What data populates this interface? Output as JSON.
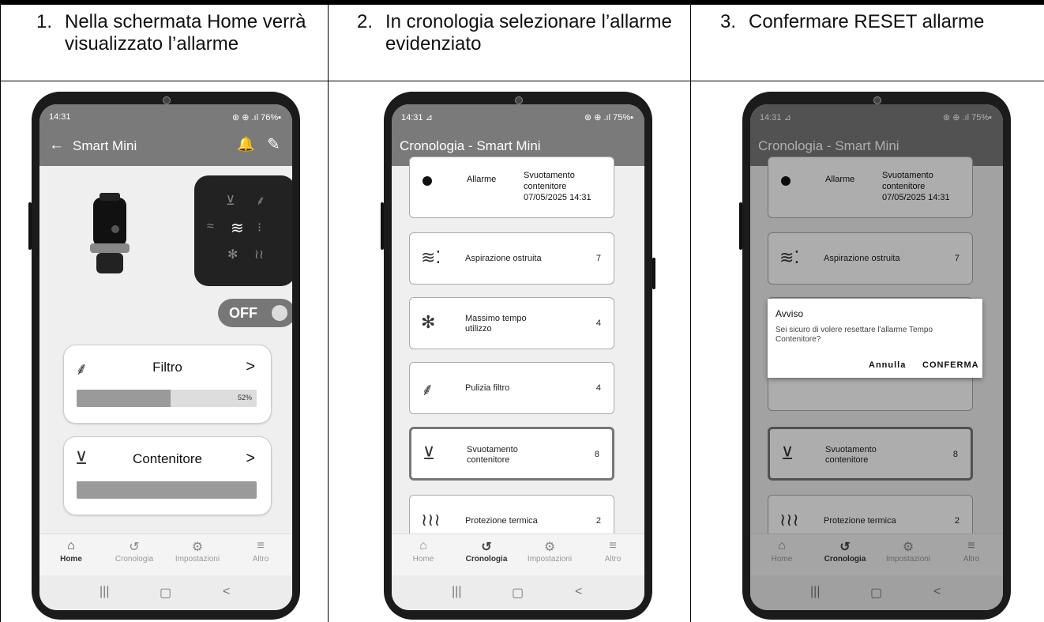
{
  "steps": [
    {
      "num": "1.",
      "text": "Nella schermata Home verrà visualizzato l’allarme"
    },
    {
      "num": "2.",
      "text": "In cronologia selezionare l’allarme evidenziato"
    },
    {
      "num": "3.",
      "text": "Confermare RESET allarme"
    }
  ],
  "phone1": {
    "time": "14:31",
    "status_right": "⊛ ⊕ .ıl 76%▪",
    "title": "Smart Mini",
    "toggle_label": "OFF",
    "filter_card": {
      "label": "Filtro",
      "percent": "52%",
      "fill_value": 0.52
    },
    "container_card": {
      "label": "Contenitore",
      "fill_value": 1.0
    },
    "nav": [
      "Home",
      "Cronologia",
      "Impostazioni",
      "Altro"
    ]
  },
  "phone2": {
    "time": "14:31 ⊿",
    "status_right": "⊛ ⊕ .ıl 75%▪",
    "title": "Cronologia - Smart Mini",
    "alarm": {
      "label": "Allarme",
      "desc1": "Svuotamento",
      "desc2": "contenitore",
      "desc3": "07/05/2025 14:31"
    },
    "items": [
      {
        "label": "Aspirazione ostruita",
        "label2": "",
        "count": "7",
        "icon": "≋⁚"
      },
      {
        "label": "Massimo tempo",
        "label2": "utilizzo",
        "count": "4",
        "icon": "✻"
      },
      {
        "label": "Pulizia filtro",
        "label2": "",
        "count": "4",
        "icon": "⸙"
      },
      {
        "label": "Svuotamento",
        "label2": "contenitore",
        "count": "8",
        "icon": "⊻"
      },
      {
        "label": "Protezione termica",
        "label2": "",
        "count": "2",
        "icon": "≀≀≀"
      }
    ],
    "nav": [
      "Home",
      "Cronologia",
      "Impostazioni",
      "Altro"
    ]
  },
  "phone3": {
    "time": "14:31 ⊿",
    "status_right": "⊛ ⊕ .ıl 75%▪",
    "title": "Cronologia - Smart Mini",
    "dialog": {
      "title": "Avviso",
      "message": "Sei sicuro di volere resettare l'allarme Tempo Contenitore?",
      "cancel": "Annulla",
      "confirm": "CONFERMA"
    }
  }
}
